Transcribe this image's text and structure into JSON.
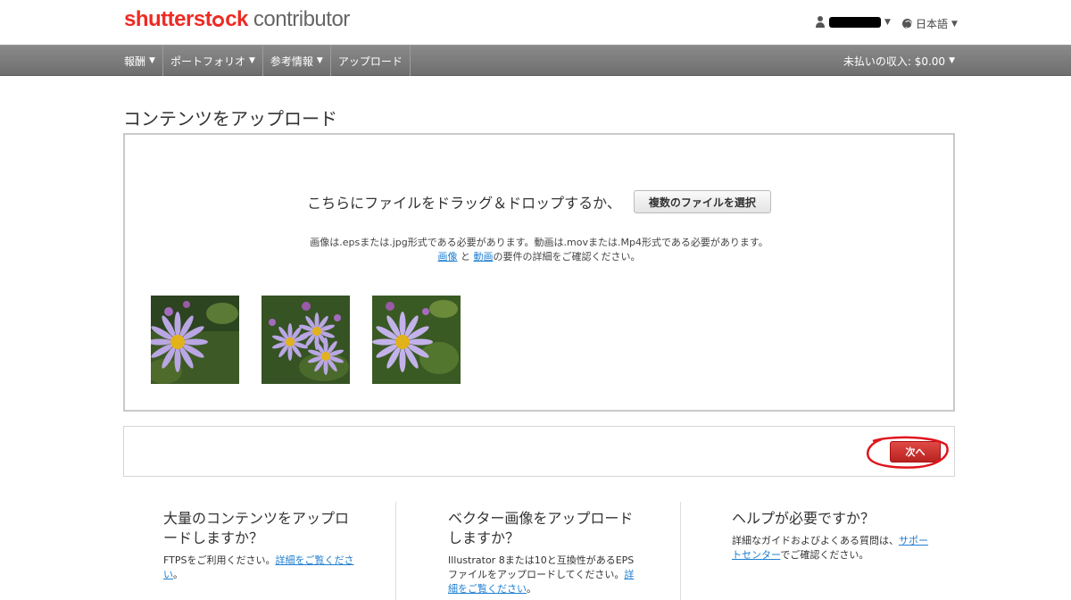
{
  "header": {
    "logo_brand_a": "shutterst",
    "logo_brand_b": "ck",
    "logo_sub": "contributor",
    "user_icon": "user-icon",
    "language": "日本語",
    "globe_icon": "globe-icon"
  },
  "nav": {
    "items": [
      {
        "label": "報酬",
        "dropdown": true
      },
      {
        "label": "ポートフォリオ",
        "dropdown": true
      },
      {
        "label": "参考情報",
        "dropdown": true
      },
      {
        "label": "アップロード",
        "dropdown": false
      }
    ],
    "earnings": "未払いの収入: $0.00"
  },
  "page": {
    "title": "コンテンツをアップロード"
  },
  "upload": {
    "drop_text": "こちらにファイルをドラッグ＆ドロップするか、",
    "select_button": "複数のファイルを選択",
    "requirement_line": "画像は.epsまたは.jpg形式である必要があります。動画は.movまたは.Mp4形式である必要があります。",
    "link_images": "画像",
    "and": " と ",
    "link_video": "動画",
    "requirement_suffix": "の要件の詳細をご確認ください。",
    "thumbnails": [
      "flower-photo-1",
      "flower-photo-2",
      "flower-photo-3"
    ]
  },
  "next_bar": {
    "next_button": "次へ"
  },
  "info": {
    "col1": {
      "title": "大量のコンテンツをアップロードしますか？",
      "text": "FTPSをご利用ください。",
      "link": "詳細をご覧ください",
      "suffix": "。"
    },
    "col2": {
      "title": "ベクター画像をアップロードしますか？",
      "text": "Illustrator 8または10と互換性があるEPSファイルをアップロードしてください。",
      "link": "詳細をご覧ください",
      "suffix": "。"
    },
    "col3": {
      "title": "ヘルプが必要ですか？",
      "text": "詳細なガイドおよびよくある質問は、",
      "link": "サポートセンター",
      "suffix": "でご確認ください。"
    }
  },
  "colors": {
    "brand_red": "#ee2b24",
    "nav_gray": "#7a7a7a",
    "link_blue": "#1f7fd1",
    "next_red": "#c8302c",
    "annotation_red": "#e0141c"
  }
}
